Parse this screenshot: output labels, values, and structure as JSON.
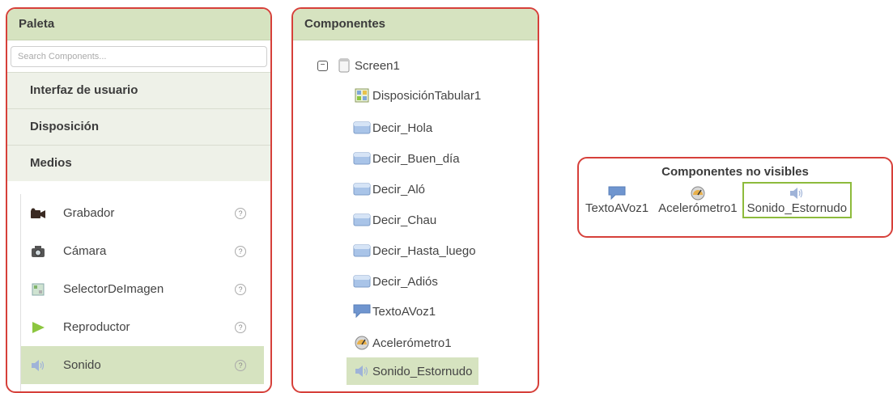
{
  "palette": {
    "title": "Paleta",
    "search_placeholder": "Search Components...",
    "categories": [
      "Interfaz de usuario",
      "Disposición",
      "Medios"
    ],
    "items": [
      {
        "label": "Grabador",
        "icon": "camcorder-icon"
      },
      {
        "label": "Cámara",
        "icon": "camera-icon"
      },
      {
        "label": "SelectorDeImagen",
        "icon": "image-picker-icon"
      },
      {
        "label": "Reproductor",
        "icon": "play-icon"
      },
      {
        "label": "Sonido",
        "icon": "speaker-icon",
        "selected": true
      }
    ],
    "help_glyph": "?"
  },
  "components": {
    "title": "Componentes",
    "collapse_glyph": "−",
    "tree": [
      {
        "label": "Screen1",
        "icon": "screen-icon"
      },
      {
        "label": "DisposiciónTabular1",
        "icon": "table-arrangement-icon"
      },
      {
        "label": "Decir_Hola",
        "icon": "button-icon"
      },
      {
        "label": "Decir_Buen_día",
        "icon": "button-icon"
      },
      {
        "label": "Decir_Aló",
        "icon": "button-icon"
      },
      {
        "label": "Decir_Chau",
        "icon": "button-icon"
      },
      {
        "label": "Decir_Hasta_luego",
        "icon": "button-icon"
      },
      {
        "label": "Decir_Adiós",
        "icon": "button-icon"
      },
      {
        "label": "TextoAVoz1",
        "icon": "speech-bubble-icon"
      },
      {
        "label": "Acelerómetro1",
        "icon": "gauge-icon"
      },
      {
        "label": "Sonido_Estornudo",
        "icon": "speaker-icon",
        "selected": true
      }
    ]
  },
  "nonvisible": {
    "title": "Componentes no visibles",
    "items": [
      {
        "label": "TextoAVoz1",
        "icon": "speech-bubble-icon"
      },
      {
        "label": "Acelerómetro1",
        "icon": "gauge-icon"
      },
      {
        "label": "Sonido_Estornudo",
        "icon": "speaker-icon",
        "selected": true
      }
    ]
  },
  "colors": {
    "border": "#d6403a",
    "header_bg": "#d6e3c0",
    "selected_bg": "#d6e3c0",
    "selected_outline": "#8dbb3c"
  }
}
